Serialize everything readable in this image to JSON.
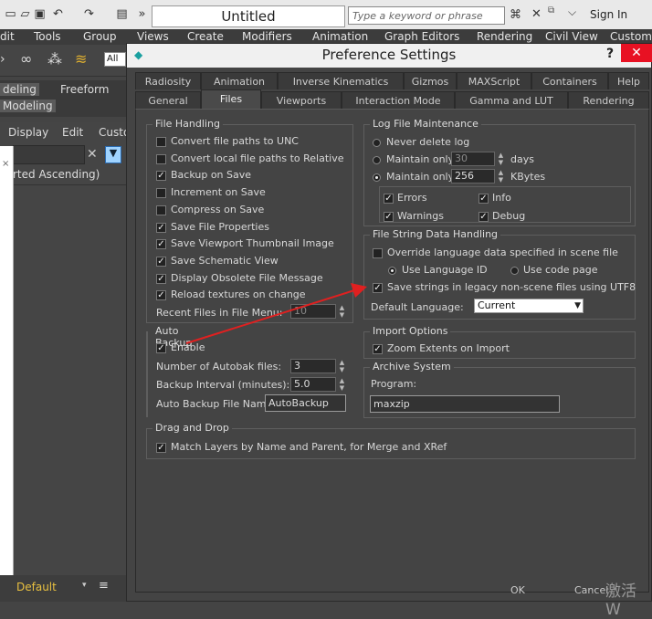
{
  "window": {
    "title": "Untitled",
    "search_placeholder": "Type a keyword or phrase",
    "signin": "Sign In"
  },
  "menus": [
    "dit",
    "Tools",
    "Group",
    "Views",
    "Create",
    "Modifiers",
    "Animation",
    "Graph Editors",
    "Rendering",
    "Civil View",
    "Customi"
  ],
  "left": {
    "selection_field": "All",
    "ribbon_tabs": [
      "deling",
      "Freeform"
    ],
    "ribbon_subtab": "Modeling",
    "scene_menus": [
      "Display",
      "Edit",
      "Custo"
    ],
    "sort_label": "rted Ascending)",
    "layer": "Default"
  },
  "dialog": {
    "title": "Preference Settings",
    "help": "?",
    "tabs_row1": [
      "Radiosity",
      "Animation",
      "Inverse Kinematics",
      "Gizmos",
      "MAXScript",
      "Containers",
      "Help"
    ],
    "tabs_row2": [
      "General",
      "Files",
      "Viewports",
      "Interaction Mode",
      "Gamma and LUT",
      "Rendering"
    ],
    "active_tab": "Files",
    "file_handling": {
      "title": "File Handling",
      "items": [
        {
          "label": "Convert file paths to UNC",
          "checked": false
        },
        {
          "label": "Convert local file paths to Relative",
          "checked": false
        },
        {
          "label": "Backup on Save",
          "checked": true
        },
        {
          "label": "Increment on Save",
          "checked": false
        },
        {
          "label": "Compress on Save",
          "checked": false
        },
        {
          "label": "Save File Properties",
          "checked": true
        },
        {
          "label": "Save Viewport Thumbnail Image",
          "checked": true
        },
        {
          "label": "Save Schematic View",
          "checked": true
        },
        {
          "label": "Display Obsolete File Message",
          "checked": true
        },
        {
          "label": "Reload textures on change",
          "checked": true
        }
      ],
      "recent_label": "Recent Files in File Menu:",
      "recent_value": "10"
    },
    "log": {
      "title": "Log File Maintenance",
      "never": "Never delete log",
      "maintain1": "Maintain only",
      "maintain1_value": "30",
      "days": "days",
      "maintain2": "Maintain only",
      "maintain2_value": "256",
      "kbytes": "KBytes",
      "errors": "Errors",
      "info": "Info",
      "warnings": "Warnings",
      "debug": "Debug"
    },
    "string": {
      "title": "File String Data Handling",
      "override": "Override language data specified in scene file",
      "use_lang": "Use Language ID",
      "use_code": "Use code page",
      "save_utf8": "Save strings in legacy non-scene files using UTF8",
      "default_lang_label": "Default Language:",
      "default_lang_value": "Current"
    },
    "auto_backup": {
      "title": "Auto Backup",
      "enable": "Enable",
      "num_label": "Number of Autobak files:",
      "num_value": "3",
      "interval_label": "Backup Interval (minutes):",
      "interval_value": "5.0",
      "name_label": "Auto Backup File Name:",
      "name_value": "AutoBackup"
    },
    "import": {
      "title": "Import Options",
      "zoom": "Zoom Extents on Import"
    },
    "archive": {
      "title": "Archive System",
      "program_label": "Program:",
      "program_value": "maxzip"
    },
    "drag": {
      "title": "Drag and Drop",
      "match": "Match Layers by Name and Parent, for Merge and XRef"
    },
    "ok": "OK",
    "cancel": "Cancel"
  },
  "watermark": "激活 W",
  "colors": {
    "close_red": "#e81123",
    "arrow_red": "#e02020"
  }
}
